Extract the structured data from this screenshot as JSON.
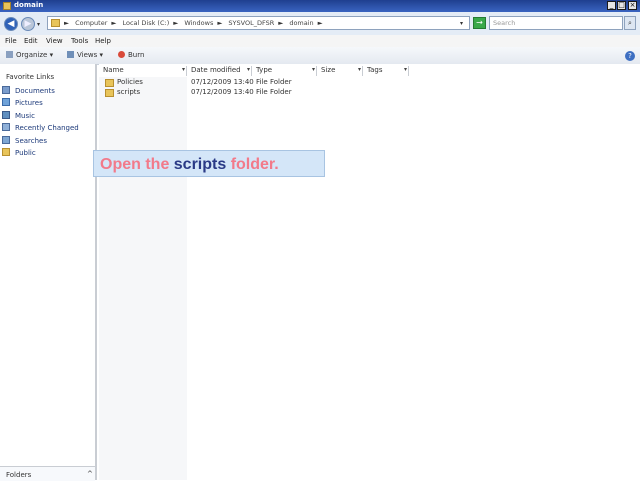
{
  "window": {
    "title": "domain"
  },
  "nav": {
    "back": "◀",
    "forward": "▶"
  },
  "address": {
    "crumbs": [
      "Computer",
      "Local Disk (C:)",
      "Windows",
      "SYSVOL_DFSR",
      "domain"
    ],
    "go_symbol": "→"
  },
  "search": {
    "placeholder": "Search"
  },
  "menu": [
    "File",
    "Edit",
    "View",
    "Tools",
    "Help"
  ],
  "toolbar": {
    "organize": "Organize",
    "views": "Views",
    "burn": "Burn"
  },
  "navpane": {
    "header": "Favorite Links",
    "items": [
      "Documents",
      "Pictures",
      "Music",
      "Recently Changed",
      "Searches",
      "Public"
    ],
    "folders": "Folders"
  },
  "columns": [
    "Name",
    "Date modified",
    "Type",
    "Size",
    "Tags"
  ],
  "files": [
    {
      "name": "Policies",
      "date": "07/12/2009 13:40",
      "type": "File Folder"
    },
    {
      "name": "scripts",
      "date": "07/12/2009 13:40",
      "type": "File Folder"
    }
  ],
  "instruction": {
    "part1": "Open the ",
    "part2": "scripts",
    "part3": " folder."
  },
  "colors": {
    "accent": "#2a3a86",
    "highlight": "#f27a8a",
    "folder": "#e8c45a"
  }
}
